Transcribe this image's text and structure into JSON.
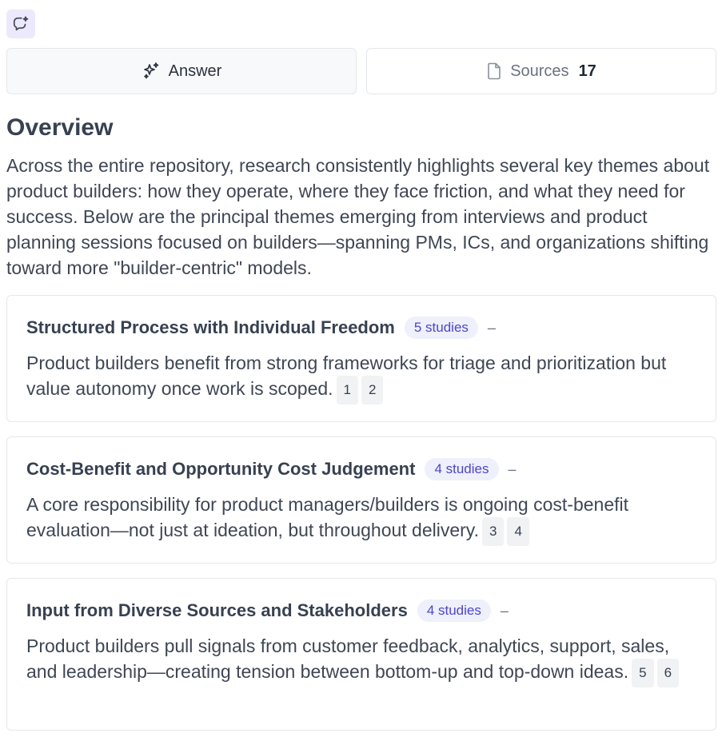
{
  "tabs": {
    "answer_label": "Answer",
    "sources_label": "Sources",
    "sources_count": "17"
  },
  "overview": {
    "title": "Overview",
    "text": "Across the entire repository, research consistently highlights several key themes about product builders: how they operate, where they face friction, and what they need for success. Below are the principal themes emerging from interviews and product planning sessions focused on builders—spanning PMs, ICs, and organizations shifting toward more \"builder-centric\" models."
  },
  "themes": [
    {
      "title": "Structured Process with Individual Freedom",
      "badge": "5 studies",
      "dash": "–",
      "body": "Product builders benefit from strong frameworks for triage and prioritization but value autonomy once work is scoped.",
      "citations": [
        "1",
        "2"
      ]
    },
    {
      "title": "Cost-Benefit and Opportunity Cost Judgement",
      "badge": "4 studies",
      "dash": "–",
      "body": "A core responsibility for product managers/builders is ongoing cost-benefit evaluation—not just at ideation, but throughout delivery.",
      "citations": [
        "3",
        "4"
      ]
    },
    {
      "title": "Input from Diverse Sources and Stakeholders",
      "badge": "4 studies",
      "dash": "–",
      "body": "Product builders pull signals from customer feedback, analytics, support, sales, and leadership—creating tension between bottom-up and top-down ideas.",
      "citations": [
        "5",
        "6"
      ]
    }
  ],
  "colors": {
    "accent": "#4f46c8",
    "badge_bg": "#eef0fb",
    "icon_bg": "#ebe9fb"
  },
  "icons": {
    "top": "chat-sparkle-icon",
    "answer": "sparkles-icon",
    "sources": "document-icon"
  }
}
